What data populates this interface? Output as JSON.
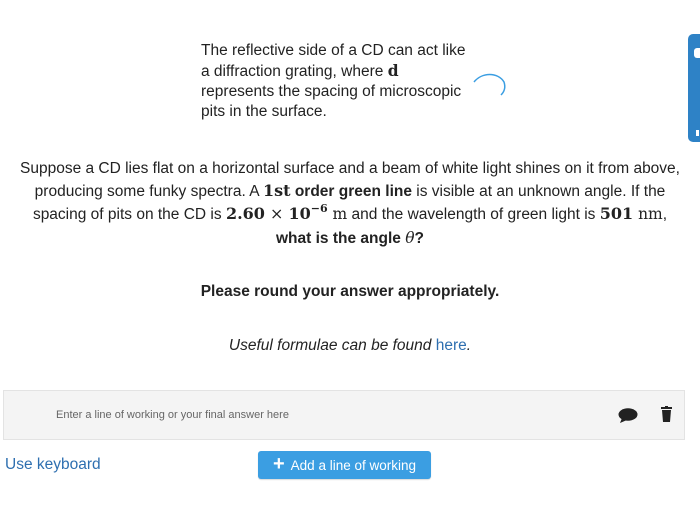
{
  "intro": {
    "line1": "The reflective side of a CD can act like",
    "line2_pre": "a diffraction grating, where ",
    "line2_var": "d",
    "line3": "represents the spacing of microscopic",
    "line4": "pits in the surface."
  },
  "question": {
    "p1": "Suppose a CD lies flat on a horizontal surface and a beam of white light shines on it from above, producing some funky spectra. A ",
    "order_num": "1st",
    "order_text": " order green line",
    "p2": " is visible at an unknown angle. If the spacing of pits on the CD is ",
    "spacing_mantissa": "2.60",
    "times": " × ",
    "base": "10",
    "exponent": "−6",
    "spacing_unit": " m",
    "p3": " and the wavelength of green light is ",
    "wavelength": "501",
    "wavelength_unit": " nm",
    "p4": ",",
    "ask": "what is the angle ",
    "theta": "θ",
    "ask_end": "?"
  },
  "round_text": "Please round your answer appropriately.",
  "formulae": {
    "text": "Useful formulae can be found ",
    "link": "here",
    "end": "."
  },
  "answer": {
    "placeholder": "Enter a line of working or your final answer here"
  },
  "use_keyboard": "Use keyboard",
  "add_line": {
    "icon": "+",
    "label": "Add a line of working"
  },
  "colors": {
    "accent": "#3b9ee2",
    "link": "#2e6fb0",
    "side_tab": "#2e82c6"
  }
}
